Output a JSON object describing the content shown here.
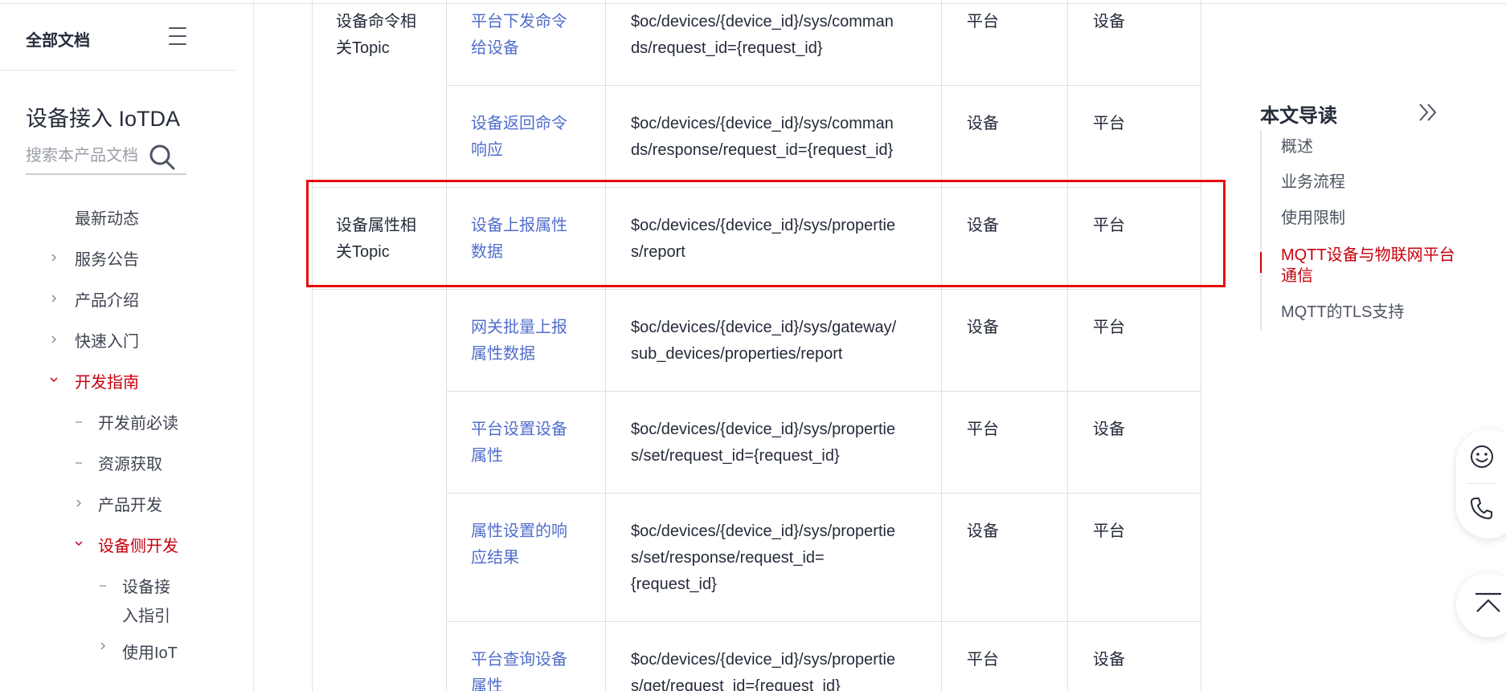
{
  "sidebar": {
    "header": "全部文档",
    "product_title": "设备接入 IoTDA",
    "search_placeholder": "搜索本产品文档",
    "nav": [
      {
        "label": "最新动态"
      },
      {
        "label": "服务公告"
      },
      {
        "label": "产品介绍"
      },
      {
        "label": "快速入门"
      },
      {
        "label": "开发指南",
        "active": true
      },
      {
        "label": "开发前必读"
      },
      {
        "label": "资源获取"
      },
      {
        "label": "产品开发"
      },
      {
        "label": "设备侧开发",
        "active": true
      },
      {
        "label_line1": "设备接",
        "label_line2": "入指引"
      },
      {
        "label": "使用IoT"
      }
    ]
  },
  "table": {
    "groups": [
      {
        "line1": "设备命令相",
        "line2": "关Topic"
      },
      {
        "line1": "设备属性相",
        "line2": "关Topic"
      }
    ],
    "rows": [
      {
        "name_l1": "平台下发命令",
        "name_l2": "给设备",
        "topic_l1": "$oc/devices/{device_id}/sys/comman",
        "topic_l2": "ds/request_id={request_id}",
        "topic_l3": "",
        "publisher": "平台",
        "subscriber": "设备"
      },
      {
        "name_l1": "设备返回命令",
        "name_l2": "响应",
        "topic_l1": "$oc/devices/{device_id}/sys/comman",
        "topic_l2": "ds/response/request_id={request_id}",
        "topic_l3": "",
        "publisher": "设备",
        "subscriber": "平台"
      },
      {
        "name_l1": "设备上报属性",
        "name_l2": "数据",
        "topic_l1": "$oc/devices/{device_id}/sys/propertie",
        "topic_l2": "s/report",
        "topic_l3": "",
        "publisher": "设备",
        "subscriber": "平台"
      },
      {
        "name_l1": "网关批量上报",
        "name_l2": "属性数据",
        "topic_l1": "$oc/devices/{device_id}/sys/gateway/",
        "topic_l2": "sub_devices/properties/report",
        "topic_l3": "",
        "publisher": "设备",
        "subscriber": "平台"
      },
      {
        "name_l1": "平台设置设备",
        "name_l2": "属性",
        "topic_l1": "$oc/devices/{device_id}/sys/propertie",
        "topic_l2": "s/set/request_id={request_id}",
        "topic_l3": "",
        "publisher": "平台",
        "subscriber": "设备"
      },
      {
        "name_l1": "属性设置的响",
        "name_l2": "应结果",
        "topic_l1": "$oc/devices/{device_id}/sys/propertie",
        "topic_l2": "s/set/response/request_id=",
        "topic_l3": "{request_id}",
        "publisher": "设备",
        "subscriber": "平台"
      },
      {
        "name_l1": "平台查询设备",
        "name_l2": "属性",
        "topic_l1": "$oc/devices/{device_id}/sys/propertie",
        "topic_l2": "s/get/request_id={request_id}",
        "topic_l3": "",
        "publisher": "平台",
        "subscriber": "设备"
      }
    ]
  },
  "toc": {
    "title": "本文导读",
    "items": [
      {
        "label": "概述"
      },
      {
        "label": "业务流程"
      },
      {
        "label": "使用限制"
      },
      {
        "label_line1": "MQTT设备与物联网平台",
        "label_line2": "通信",
        "active": true
      },
      {
        "label": "MQTT的TLS支持"
      }
    ]
  },
  "colors": {
    "accent_red": "#c7000b",
    "link_blue": "#526ecc",
    "highlight_red": "#e8090f"
  },
  "icons": {
    "menu": "hamburger-icon",
    "search": "search-icon",
    "collapse": "double-chevron-right-icon",
    "feedback": "smiley-icon",
    "contact": "phone-icon",
    "back_to_top": "back-to-top-icon"
  }
}
